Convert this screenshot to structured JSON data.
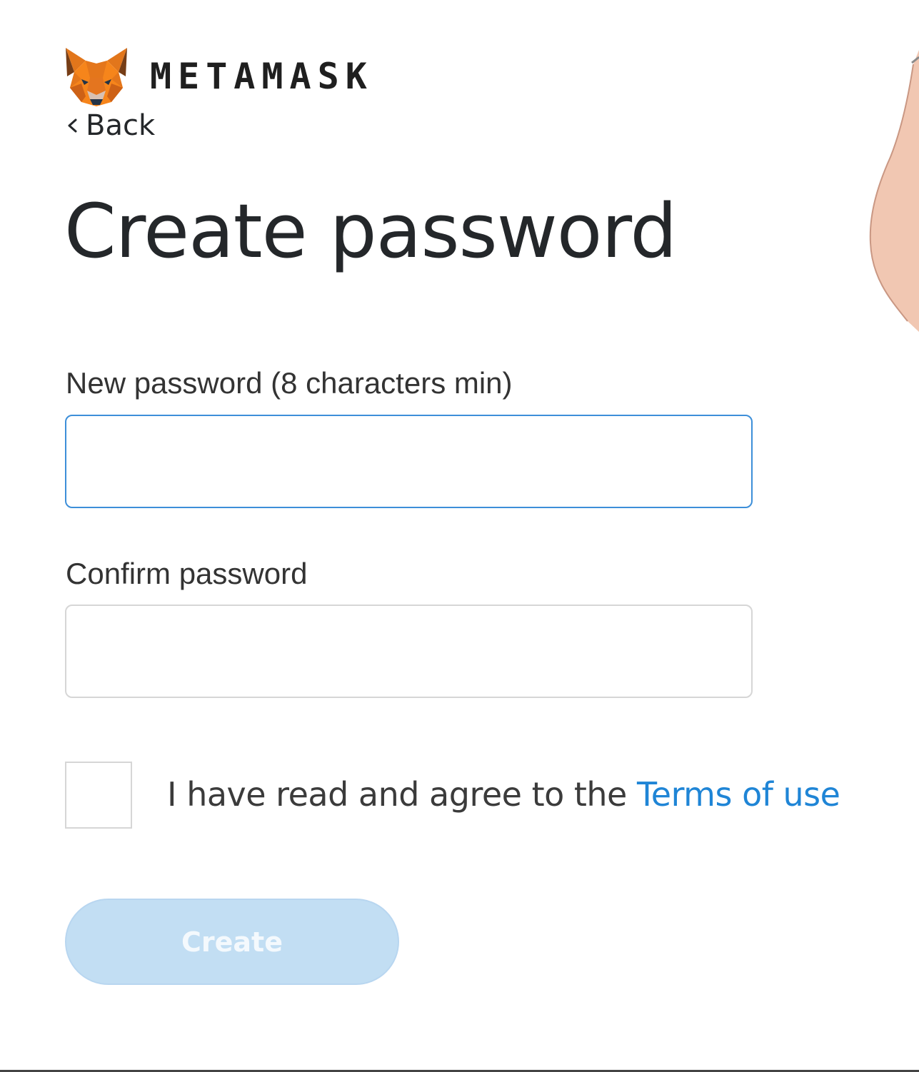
{
  "brand": {
    "logo_icon": "metamask-fox-icon",
    "wordmark": "METAMASK"
  },
  "nav": {
    "back_label": "Back"
  },
  "page": {
    "title": "Create password"
  },
  "form": {
    "new_password_label": "New password (8 characters min)",
    "new_password_value": "",
    "confirm_password_label": "Confirm password",
    "confirm_password_value": "",
    "terms_checked": false,
    "terms_text": "I have read and agree to the ",
    "terms_link": "Terms of use",
    "create_label": "Create",
    "create_enabled": false
  },
  "colors": {
    "accent": "#1f85d6",
    "focus_border": "#3d8fd9",
    "button_disabled_bg": "#c2def3",
    "fox_orange": "#e2761b"
  }
}
